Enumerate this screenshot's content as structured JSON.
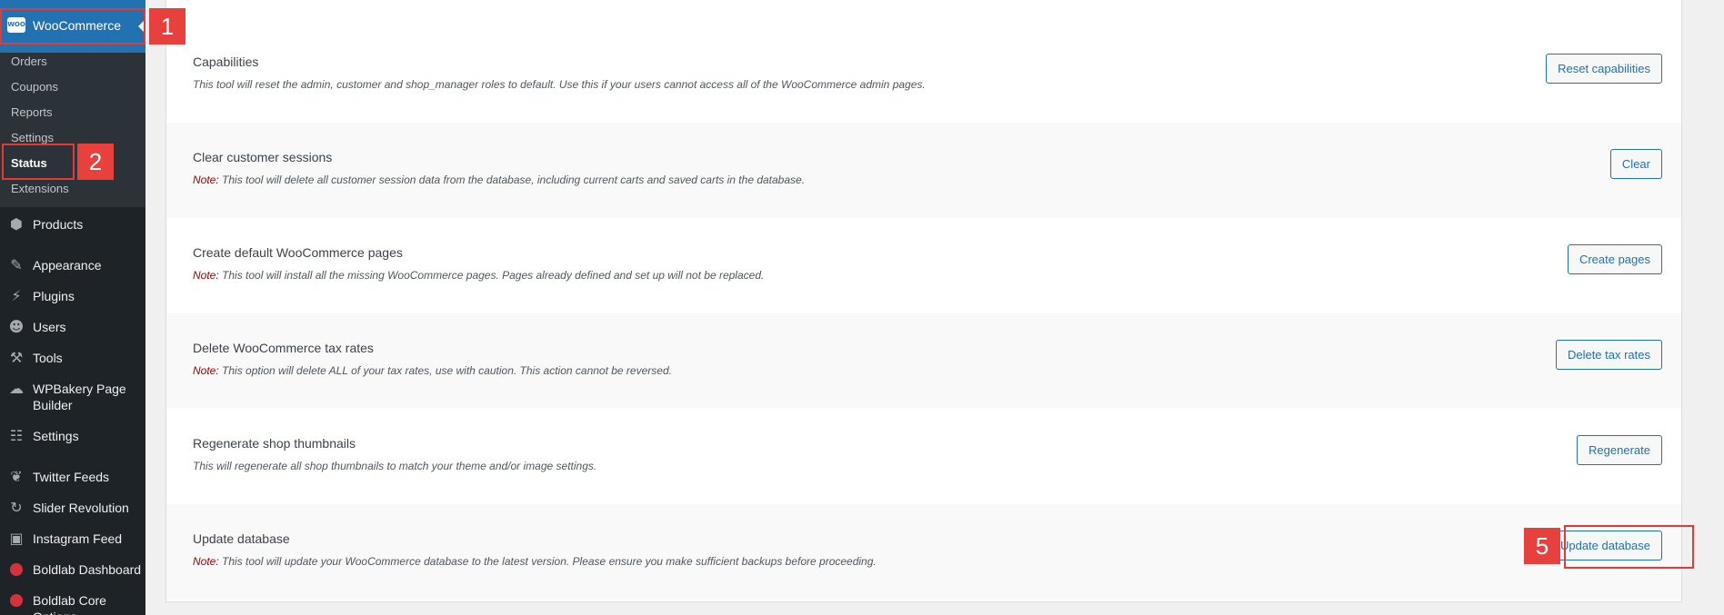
{
  "sidebar": {
    "woocommerce_label": "WooCommerce",
    "woo_logo_text": "WOO",
    "submenu": [
      "Orders",
      "Coupons",
      "Reports",
      "Settings",
      "Status",
      "Extensions"
    ],
    "menu": [
      {
        "label": "Products",
        "icon": "box-icon"
      },
      {
        "label": "Appearance",
        "icon": "brush-icon"
      },
      {
        "label": "Plugins",
        "icon": "plug-icon"
      },
      {
        "label": "Users",
        "icon": "user-icon"
      },
      {
        "label": "Tools",
        "icon": "wrench-icon"
      },
      {
        "label": "WPBakery Page Builder",
        "icon": "cloud-icon"
      },
      {
        "label": "Settings",
        "icon": "sliders-icon"
      },
      {
        "label": "Twitter Feeds",
        "icon": "twitter-icon"
      },
      {
        "label": "Slider Revolution",
        "icon": "refresh-icon"
      },
      {
        "label": "Instagram Feed",
        "icon": "camera-icon"
      },
      {
        "label": "Boldlab Dashboard",
        "icon": "red-dot-icon"
      },
      {
        "label": "Boldlab Core Options",
        "icon": "red-dot-icon"
      }
    ]
  },
  "annotations": [
    "1",
    "2",
    "5"
  ],
  "tools": [
    {
      "title": "Capabilities",
      "note": "",
      "desc": "This tool will reset the admin, customer and shop_manager roles to default. Use this if your users cannot access all of the WooCommerce admin pages.",
      "button": "Reset capabilities"
    },
    {
      "title": "Clear customer sessions",
      "note": "Note:",
      "desc": " This tool will delete all customer session data from the database, including current carts and saved carts in the database.",
      "button": "Clear"
    },
    {
      "title": "Create default WooCommerce pages",
      "note": "Note:",
      "desc": " This tool will install all the missing WooCommerce pages. Pages already defined and set up will not be replaced.",
      "button": "Create pages"
    },
    {
      "title": "Delete WooCommerce tax rates",
      "note": "Note:",
      "desc": " This option will delete ALL of your tax rates, use with caution. This action cannot be reversed.",
      "button": "Delete tax rates"
    },
    {
      "title": "Regenerate shop thumbnails",
      "note": "",
      "desc": "This will regenerate all shop thumbnails to match your theme and/or image settings.",
      "button": "Regenerate"
    },
    {
      "title": "Update database",
      "note": "Note:",
      "desc": " This tool will update your WooCommerce database to the latest version. Please ensure you make sufficient backups before proceeding.",
      "button": "Update database"
    }
  ],
  "colors": {
    "sidebar": "#1d2327",
    "active": "#2271b1",
    "annotation": "#e53935",
    "note": "#aa0000"
  }
}
